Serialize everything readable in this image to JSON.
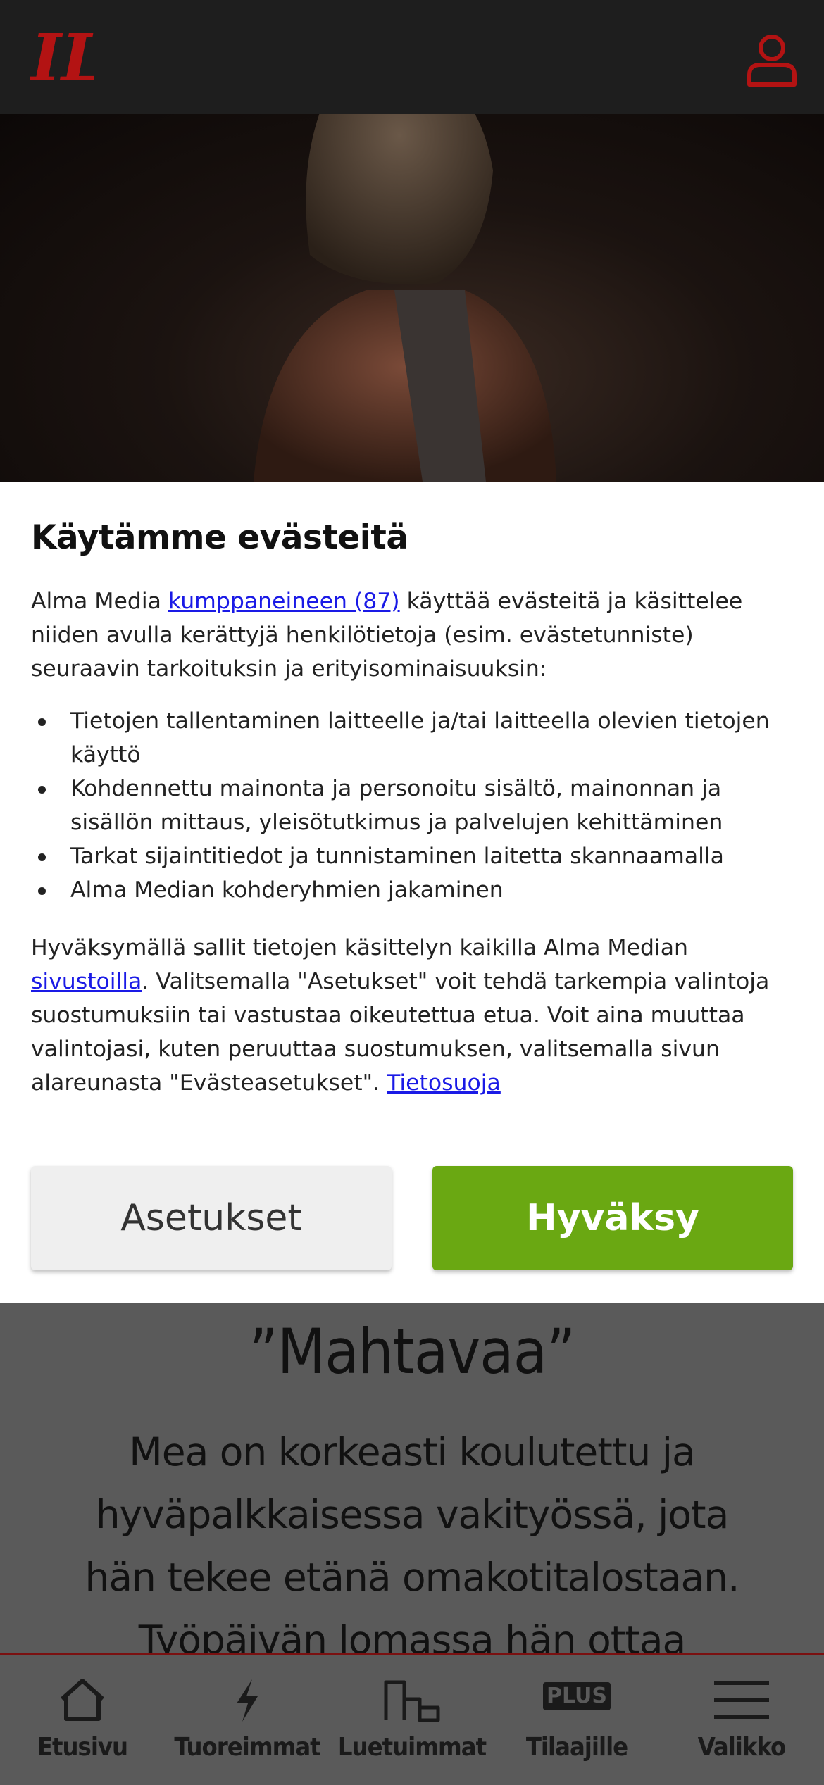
{
  "header": {
    "logo_text": "IL",
    "account_icon": "user-icon"
  },
  "cookie": {
    "title": "Käytämme evästeitä",
    "intro_before": "Alma Media ",
    "partners_link": "kumppaneineen (87)",
    "intro_after": " käyttää evästeitä ja käsittelee niiden avulla kerättyjä henkilötietoja (esim. evästetunniste) seuraavin tarkoituksin ja erityisominaisuuksin:",
    "purposes": [
      "Tietojen tallentaminen laitteelle ja/tai laitteella olevien tietojen käyttö",
      "Kohdennettu mainonta ja personoitu sisältö, mainonnan ja sisällön mittaus, yleisötutkimus ja palvelujen kehittäminen",
      "Tarkat sijaintitiedot ja tunnistaminen laitetta skannaamalla",
      "Alma Median kohderyhmien jakaminen"
    ],
    "outro_before": "Hyväksymällä sallit tietojen käsittelyn kaikilla Alma Median ",
    "sites_link": "sivustoilla",
    "outro_middle": ". Valitsemalla \"Asetukset\" voit tehdä tarkempia valintoja suostumuksiin tai vastustaa oikeutettua etua. Voit aina muuttaa valintojasi, kuten peruuttaa suostumuksen, valitsemalla sivun alareunasta \"Evästeasetukset\". ",
    "privacy_link": "Tietosuoja",
    "settings_button": "Asetukset",
    "accept_button": "Hyväksy",
    "accept_color": "#6aa812"
  },
  "article": {
    "quote_title": "”Mahtavaa”",
    "body": "Mea on korkeasti koulutettu ja hyväpalkkaisessa vakityössä, jota hän tekee etänä omakotitalostaan. Työpäivän lomassa hän ottaa vastaan"
  },
  "bottom_nav": {
    "items": [
      {
        "label": "Etusivu",
        "icon": "home-icon"
      },
      {
        "label": "Tuoreimmat",
        "icon": "lightning-icon"
      },
      {
        "label": "Luetuimmat",
        "icon": "ranking-icon"
      },
      {
        "label": "Tilaajille",
        "icon": "plus-badge-icon",
        "badge": "PLUS"
      },
      {
        "label": "Valikko",
        "icon": "menu-icon"
      }
    ]
  },
  "colors": {
    "brand_red": "#b31313",
    "header_bg": "#1e1e1e",
    "link": "#1a1ae6"
  }
}
